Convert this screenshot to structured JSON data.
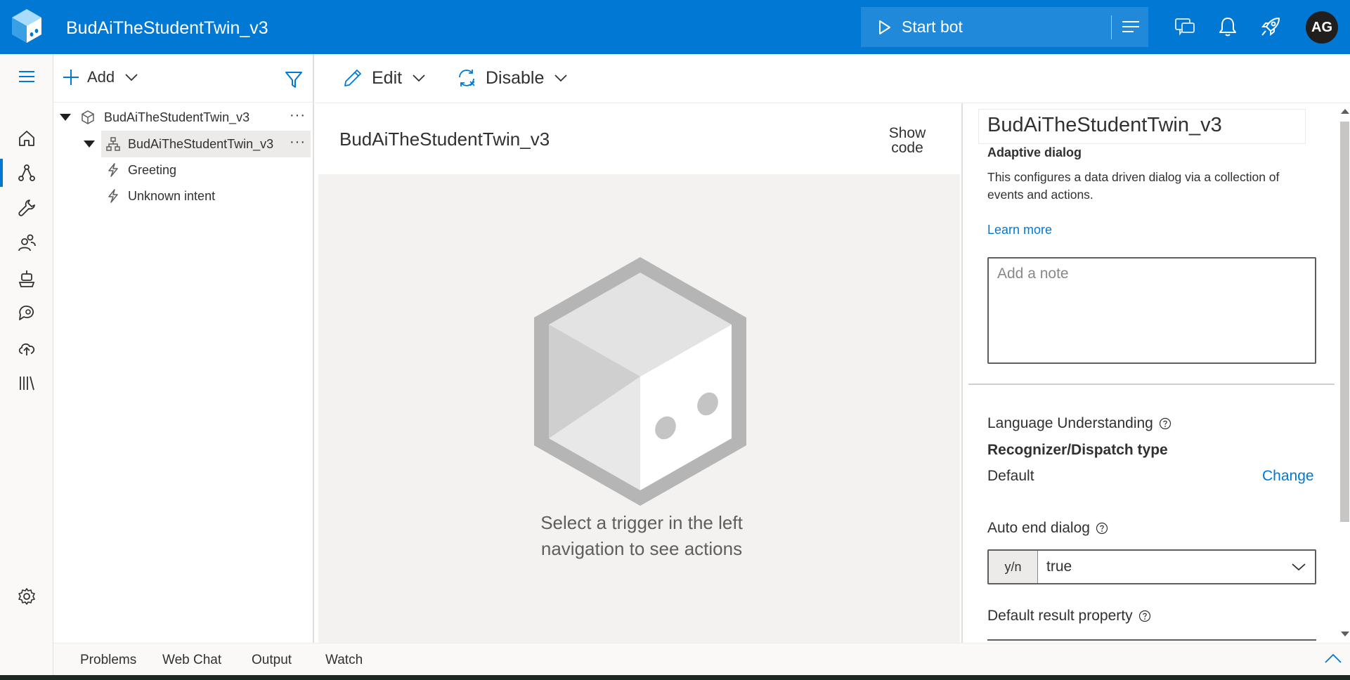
{
  "header": {
    "app_title": "BudAiTheStudentTwin_v3",
    "start_bot_label": "Start bot",
    "avatar_initials": "AG",
    "icons": [
      "logo-icon",
      "play-icon",
      "hamburger-icon",
      "chat-icon",
      "bell-icon",
      "rocket-icon"
    ],
    "colors": {
      "brand": "#0078d4",
      "avatar_bg": "#201f1e"
    }
  },
  "rail": {
    "items": [
      {
        "name": "menu",
        "icon": "hamburger-icon"
      },
      {
        "name": "home",
        "icon": "home-icon"
      },
      {
        "name": "design",
        "icon": "flow-icon",
        "active": true
      },
      {
        "name": "configure",
        "icon": "wrench-icon"
      },
      {
        "name": "users",
        "icon": "people-icon"
      },
      {
        "name": "bot-responses",
        "icon": "robot-icon"
      },
      {
        "name": "knowledge",
        "icon": "chat-search-icon"
      },
      {
        "name": "publish",
        "icon": "cloud-upload-icon"
      },
      {
        "name": "library",
        "icon": "library-icon"
      },
      {
        "name": "settings",
        "icon": "gear-icon"
      }
    ]
  },
  "nav": {
    "add_label": "Add",
    "tree": [
      {
        "label": "BudAiTheStudentTwin_v3",
        "level": 0,
        "icon": "cube-icon",
        "more": "···"
      },
      {
        "label": "BudAiTheStudentTwin_v3",
        "level": 1,
        "icon": "dialog-icon",
        "selected": true,
        "more": "···"
      },
      {
        "label": "Greeting",
        "level": 2,
        "icon": "lightning-icon"
      },
      {
        "label": "Unknown intent",
        "level": 2,
        "icon": "lightning-icon"
      }
    ]
  },
  "toolbar": {
    "edit_label": "Edit",
    "disable_label": "Disable"
  },
  "canvas": {
    "title": "BudAiTheStudentTwin_v3",
    "show_code_line1": "Show",
    "show_code_line2": "code",
    "message_line1": "Select a trigger in the left",
    "message_line2": "navigation to see actions"
  },
  "properties": {
    "title": "BudAiTheStudentTwin_v3",
    "subtitle": "Adaptive dialog",
    "description": "This configures a data driven dialog via a collection of events and actions.",
    "learn_more": "Learn more",
    "note_placeholder": "Add a note",
    "language_understanding_label": "Language Understanding",
    "recognizer_type_label": "Recognizer/Dispatch type",
    "recognizer_value": "Default",
    "change_label": "Change",
    "auto_end_label": "Auto end dialog",
    "auto_end_prefix": "y/n",
    "auto_end_value": "true",
    "default_result_label": "Default result property"
  },
  "bottom_panel": {
    "tabs": [
      "Problems",
      "Web Chat",
      "Output",
      "Watch"
    ]
  }
}
